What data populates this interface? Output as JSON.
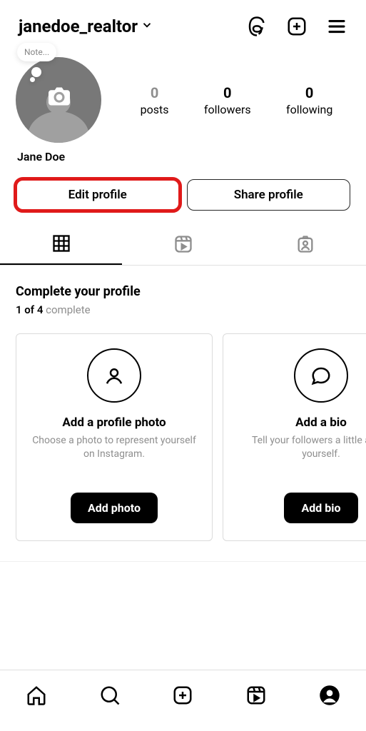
{
  "header": {
    "username": "janedoe_realtor"
  },
  "note": {
    "placeholder": "Note..."
  },
  "stats": {
    "posts": {
      "value": "0",
      "label": "posts"
    },
    "followers": {
      "value": "0",
      "label": "followers"
    },
    "following": {
      "value": "0",
      "label": "following"
    }
  },
  "profile": {
    "display_name": "Jane Doe"
  },
  "buttons": {
    "edit_profile": "Edit profile",
    "share_profile": "Share profile"
  },
  "complete": {
    "title": "Complete your profile",
    "progress_bold": "1 of 4",
    "progress_rest": " complete"
  },
  "cards": [
    {
      "title": "Add a profile photo",
      "desc": "Choose a photo to represent yourself on Instagram.",
      "button": "Add photo"
    },
    {
      "title": "Add a bio",
      "desc": "Tell your followers a little about yourself.",
      "button": "Add bio"
    }
  ]
}
